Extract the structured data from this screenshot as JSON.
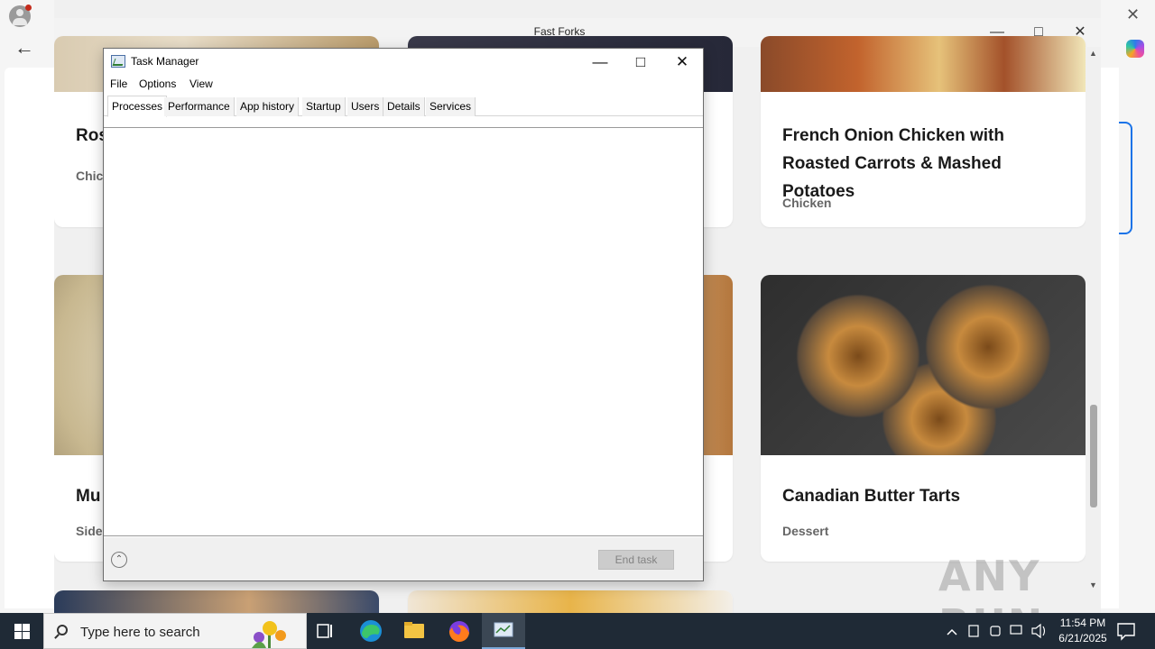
{
  "app": {
    "title": "Fast Forks"
  },
  "cards": [
    {
      "title": "Ros",
      "category": "Chic"
    },
    {
      "title": "French Onion Chicken with Roasted Carrots & Mashed Potatoes",
      "category": "Chicken"
    },
    {
      "title": "Mu",
      "category": "Side"
    },
    {
      "title": "Canadian Butter Tarts",
      "category": "Dessert"
    }
  ],
  "task_manager": {
    "title": "Task Manager",
    "menu": [
      "File",
      "Options",
      "View"
    ],
    "tabs": [
      "Processes",
      "Performance",
      "App history",
      "Startup",
      "Users",
      "Details",
      "Services"
    ],
    "active_tab": "Processes",
    "end_task_label": "End task"
  },
  "taskbar": {
    "search_placeholder": "Type here to search",
    "time": "11:54 PM",
    "date": "6/21/2025"
  },
  "watermark": "ANY RUN",
  "colors": {
    "taskbar_bg": "#1f2a36",
    "accent": "#1a73e8"
  }
}
